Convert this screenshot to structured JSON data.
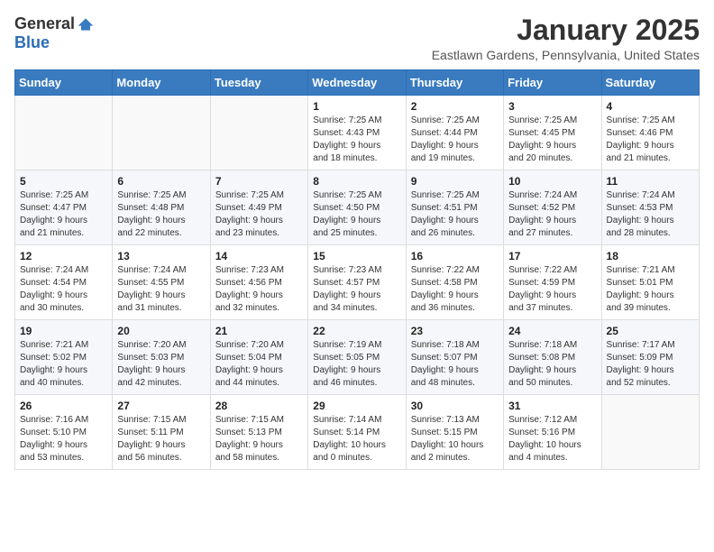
{
  "logo": {
    "general": "General",
    "blue": "Blue"
  },
  "title": "January 2025",
  "location": "Eastlawn Gardens, Pennsylvania, United States",
  "weekdays": [
    "Sunday",
    "Monday",
    "Tuesday",
    "Wednesday",
    "Thursday",
    "Friday",
    "Saturday"
  ],
  "weeks": [
    [
      {
        "day": "",
        "info": ""
      },
      {
        "day": "",
        "info": ""
      },
      {
        "day": "",
        "info": ""
      },
      {
        "day": "1",
        "info": "Sunrise: 7:25 AM\nSunset: 4:43 PM\nDaylight: 9 hours\nand 18 minutes."
      },
      {
        "day": "2",
        "info": "Sunrise: 7:25 AM\nSunset: 4:44 PM\nDaylight: 9 hours\nand 19 minutes."
      },
      {
        "day": "3",
        "info": "Sunrise: 7:25 AM\nSunset: 4:45 PM\nDaylight: 9 hours\nand 20 minutes."
      },
      {
        "day": "4",
        "info": "Sunrise: 7:25 AM\nSunset: 4:46 PM\nDaylight: 9 hours\nand 21 minutes."
      }
    ],
    [
      {
        "day": "5",
        "info": "Sunrise: 7:25 AM\nSunset: 4:47 PM\nDaylight: 9 hours\nand 21 minutes."
      },
      {
        "day": "6",
        "info": "Sunrise: 7:25 AM\nSunset: 4:48 PM\nDaylight: 9 hours\nand 22 minutes."
      },
      {
        "day": "7",
        "info": "Sunrise: 7:25 AM\nSunset: 4:49 PM\nDaylight: 9 hours\nand 23 minutes."
      },
      {
        "day": "8",
        "info": "Sunrise: 7:25 AM\nSunset: 4:50 PM\nDaylight: 9 hours\nand 25 minutes."
      },
      {
        "day": "9",
        "info": "Sunrise: 7:25 AM\nSunset: 4:51 PM\nDaylight: 9 hours\nand 26 minutes."
      },
      {
        "day": "10",
        "info": "Sunrise: 7:24 AM\nSunset: 4:52 PM\nDaylight: 9 hours\nand 27 minutes."
      },
      {
        "day": "11",
        "info": "Sunrise: 7:24 AM\nSunset: 4:53 PM\nDaylight: 9 hours\nand 28 minutes."
      }
    ],
    [
      {
        "day": "12",
        "info": "Sunrise: 7:24 AM\nSunset: 4:54 PM\nDaylight: 9 hours\nand 30 minutes."
      },
      {
        "day": "13",
        "info": "Sunrise: 7:24 AM\nSunset: 4:55 PM\nDaylight: 9 hours\nand 31 minutes."
      },
      {
        "day": "14",
        "info": "Sunrise: 7:23 AM\nSunset: 4:56 PM\nDaylight: 9 hours\nand 32 minutes."
      },
      {
        "day": "15",
        "info": "Sunrise: 7:23 AM\nSunset: 4:57 PM\nDaylight: 9 hours\nand 34 minutes."
      },
      {
        "day": "16",
        "info": "Sunrise: 7:22 AM\nSunset: 4:58 PM\nDaylight: 9 hours\nand 36 minutes."
      },
      {
        "day": "17",
        "info": "Sunrise: 7:22 AM\nSunset: 4:59 PM\nDaylight: 9 hours\nand 37 minutes."
      },
      {
        "day": "18",
        "info": "Sunrise: 7:21 AM\nSunset: 5:01 PM\nDaylight: 9 hours\nand 39 minutes."
      }
    ],
    [
      {
        "day": "19",
        "info": "Sunrise: 7:21 AM\nSunset: 5:02 PM\nDaylight: 9 hours\nand 40 minutes."
      },
      {
        "day": "20",
        "info": "Sunrise: 7:20 AM\nSunset: 5:03 PM\nDaylight: 9 hours\nand 42 minutes."
      },
      {
        "day": "21",
        "info": "Sunrise: 7:20 AM\nSunset: 5:04 PM\nDaylight: 9 hours\nand 44 minutes."
      },
      {
        "day": "22",
        "info": "Sunrise: 7:19 AM\nSunset: 5:05 PM\nDaylight: 9 hours\nand 46 minutes."
      },
      {
        "day": "23",
        "info": "Sunrise: 7:18 AM\nSunset: 5:07 PM\nDaylight: 9 hours\nand 48 minutes."
      },
      {
        "day": "24",
        "info": "Sunrise: 7:18 AM\nSunset: 5:08 PM\nDaylight: 9 hours\nand 50 minutes."
      },
      {
        "day": "25",
        "info": "Sunrise: 7:17 AM\nSunset: 5:09 PM\nDaylight: 9 hours\nand 52 minutes."
      }
    ],
    [
      {
        "day": "26",
        "info": "Sunrise: 7:16 AM\nSunset: 5:10 PM\nDaylight: 9 hours\nand 53 minutes."
      },
      {
        "day": "27",
        "info": "Sunrise: 7:15 AM\nSunset: 5:11 PM\nDaylight: 9 hours\nand 56 minutes."
      },
      {
        "day": "28",
        "info": "Sunrise: 7:15 AM\nSunset: 5:13 PM\nDaylight: 9 hours\nand 58 minutes."
      },
      {
        "day": "29",
        "info": "Sunrise: 7:14 AM\nSunset: 5:14 PM\nDaylight: 10 hours\nand 0 minutes."
      },
      {
        "day": "30",
        "info": "Sunrise: 7:13 AM\nSunset: 5:15 PM\nDaylight: 10 hours\nand 2 minutes."
      },
      {
        "day": "31",
        "info": "Sunrise: 7:12 AM\nSunset: 5:16 PM\nDaylight: 10 hours\nand 4 minutes."
      },
      {
        "day": "",
        "info": ""
      }
    ]
  ]
}
